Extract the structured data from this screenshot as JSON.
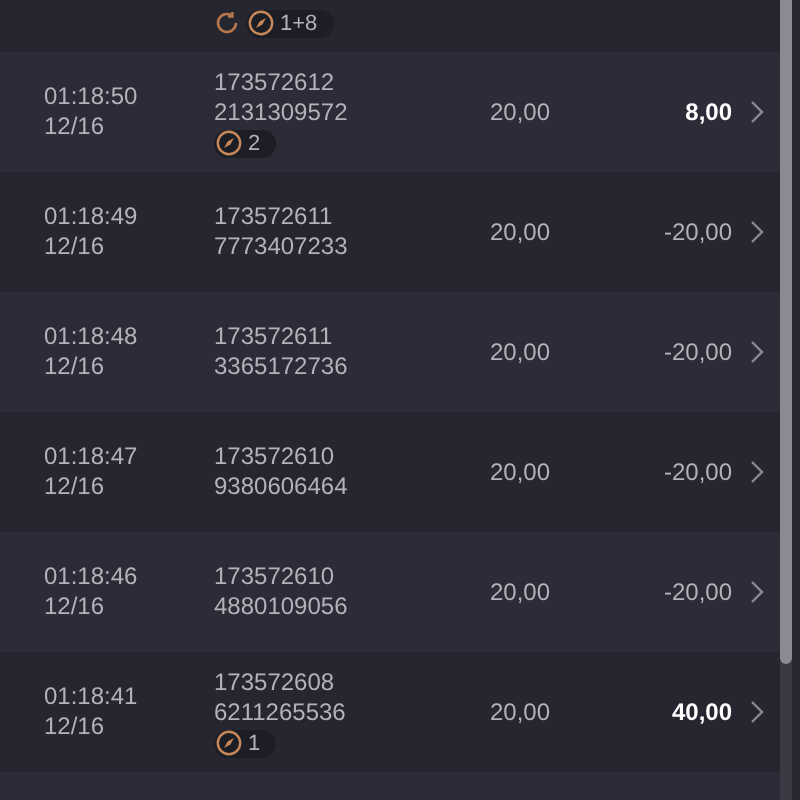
{
  "rows": [
    {
      "badges": [
        {
          "kind": "refresh"
        },
        {
          "kind": "free",
          "count": "1+8"
        }
      ]
    },
    {
      "time": "01:18:50",
      "date": "12/16",
      "round": "173572612",
      "ticket": "2131309572",
      "bet": "20,00",
      "result": "8,00",
      "win": true,
      "badges": [
        {
          "kind": "free",
          "count": "2"
        }
      ]
    },
    {
      "time": "01:18:49",
      "date": "12/16",
      "round": "173572611",
      "ticket": "7773407233",
      "bet": "20,00",
      "result": "-20,00",
      "win": false
    },
    {
      "time": "01:18:48",
      "date": "12/16",
      "round": "173572611",
      "ticket": "3365172736",
      "bet": "20,00",
      "result": "-20,00",
      "win": false
    },
    {
      "time": "01:18:47",
      "date": "12/16",
      "round": "173572610",
      "ticket": "9380606464",
      "bet": "20,00",
      "result": "-20,00",
      "win": false
    },
    {
      "time": "01:18:46",
      "date": "12/16",
      "round": "173572610",
      "ticket": "4880109056",
      "bet": "20,00",
      "result": "-20,00",
      "win": false
    },
    {
      "time": "01:18:41",
      "date": "12/16",
      "round": "173572608",
      "ticket": "6211265536",
      "bet": "20,00",
      "result": "40,00",
      "win": true,
      "badges": [
        {
          "kind": "free",
          "count": "1"
        }
      ]
    },
    {}
  ]
}
